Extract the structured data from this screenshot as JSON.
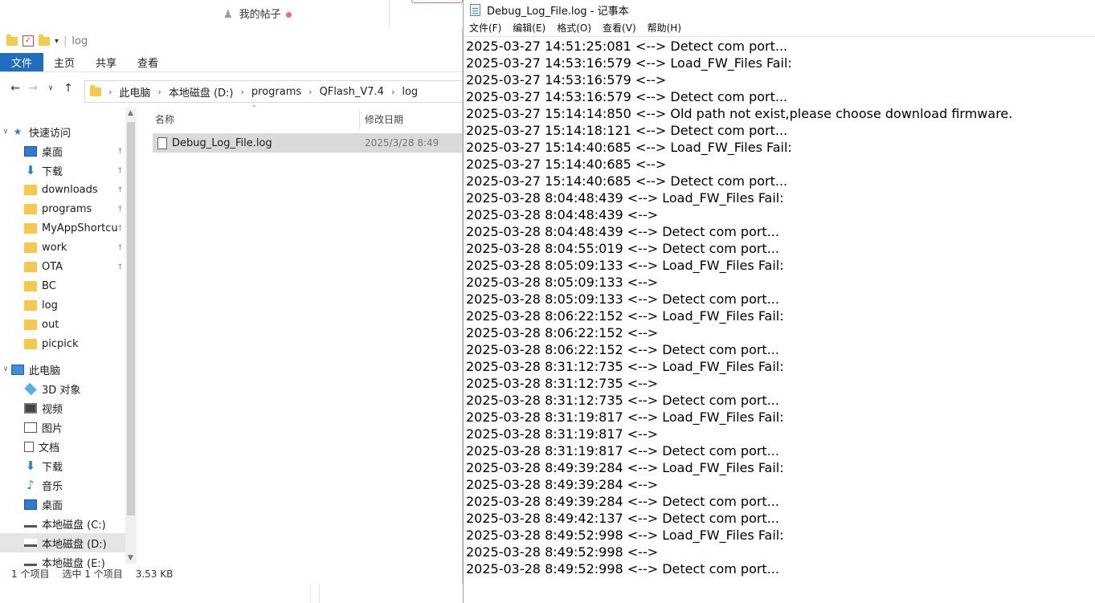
{
  "background": {
    "user_label": "我的帖子"
  },
  "explorer": {
    "title": "log",
    "ribbon_tabs": [
      "文件",
      "主页",
      "共享",
      "查看"
    ],
    "breadcrumb": [
      "此电脑",
      "本地磁盘 (D:)",
      "programs",
      "QFlash_V7.4",
      "log"
    ],
    "quick_access_label": "快速访问",
    "quick_access": [
      {
        "label": "桌面",
        "icon": "desktop-icon",
        "pinned": true
      },
      {
        "label": "下载",
        "icon": "download-icon",
        "pinned": true
      },
      {
        "label": "downloads",
        "icon": "folder-icon",
        "pinned": true
      },
      {
        "label": "programs",
        "icon": "folder-icon",
        "pinned": true
      },
      {
        "label": "MyAppShortcu",
        "icon": "folder-icon",
        "pinned": true
      },
      {
        "label": "work",
        "icon": "folder-icon",
        "pinned": true
      },
      {
        "label": "OTA",
        "icon": "folder-icon",
        "pinned": true
      },
      {
        "label": "BC",
        "icon": "folder-icon",
        "pinned": false
      },
      {
        "label": "log",
        "icon": "folder-icon",
        "pinned": false
      },
      {
        "label": "out",
        "icon": "folder-icon",
        "pinned": false
      },
      {
        "label": "picpick",
        "icon": "folder-icon",
        "pinned": false
      }
    ],
    "this_pc_label": "此电脑",
    "this_pc": [
      {
        "label": "3D 对象",
        "icon": "3d-objects-icon"
      },
      {
        "label": "视频",
        "icon": "video-icon"
      },
      {
        "label": "图片",
        "icon": "pictures-icon"
      },
      {
        "label": "文档",
        "icon": "documents-icon"
      },
      {
        "label": "下载",
        "icon": "download-icon"
      },
      {
        "label": "音乐",
        "icon": "music-icon"
      },
      {
        "label": "桌面",
        "icon": "desktop-icon"
      },
      {
        "label": "本地磁盘 (C:)",
        "icon": "drive-icon"
      },
      {
        "label": "本地磁盘 (D:)",
        "icon": "drive-icon",
        "selected": true
      },
      {
        "label": "本地磁盘 (E:)",
        "icon": "drive-icon"
      }
    ],
    "columns": {
      "name": "名称",
      "modified": "修改日期"
    },
    "files": [
      {
        "name": "Debug_Log_File.log",
        "modified": "2025/3/28 8:49"
      }
    ],
    "status": {
      "count": "1 个项目",
      "selected": "选中 1 个项目",
      "size": "3.53 KB"
    }
  },
  "notepad": {
    "title": "Debug_Log_File.log - 记事本",
    "menu": [
      "文件(F)",
      "编辑(E)",
      "格式(O)",
      "查看(V)",
      "帮助(H)"
    ],
    "lines": [
      "2025-03-27 14:51:25:081 <--> Detect com port...",
      "2025-03-27 14:53:16:579 <--> Load_FW_Files Fail:",
      "2025-03-27 14:53:16:579 <-->",
      "2025-03-27 14:53:16:579 <--> Detect com port...",
      "2025-03-27 15:14:14:850 <--> Old path not exist,please choose download firmware.",
      "2025-03-27 15:14:18:121 <--> Detect com port...",
      "2025-03-27 15:14:40:685 <--> Load_FW_Files Fail:",
      "2025-03-27 15:14:40:685 <-->",
      "2025-03-27 15:14:40:685 <--> Detect com port...",
      "2025-03-28 8:04:48:439 <--> Load_FW_Files Fail:",
      "2025-03-28 8:04:48:439 <-->",
      "2025-03-28 8:04:48:439 <--> Detect com port...",
      "2025-03-28 8:04:55:019 <--> Detect com port...",
      "2025-03-28 8:05:09:133 <--> Load_FW_Files Fail:",
      "2025-03-28 8:05:09:133 <-->",
      "2025-03-28 8:05:09:133 <--> Detect com port...",
      "2025-03-28 8:06:22:152 <--> Load_FW_Files Fail:",
      "2025-03-28 8:06:22:152 <-->",
      "2025-03-28 8:06:22:152 <--> Detect com port...",
      "2025-03-28 8:31:12:735 <--> Load_FW_Files Fail:",
      "2025-03-28 8:31:12:735 <-->",
      "2025-03-28 8:31:12:735 <--> Detect com port...",
      "2025-03-28 8:31:19:817 <--> Load_FW_Files Fail:",
      "2025-03-28 8:31:19:817 <-->",
      "2025-03-28 8:31:19:817 <--> Detect com port...",
      "2025-03-28 8:49:39:284 <--> Load_FW_Files Fail:",
      "2025-03-28 8:49:39:284 <-->",
      "2025-03-28 8:49:39:284 <--> Detect com port...",
      "2025-03-28 8:49:42:137 <--> Detect com port...",
      "2025-03-28 8:49:52:998 <--> Load_FW_Files Fail:",
      "2025-03-28 8:49:52:998 <-->",
      "2025-03-28 8:49:52:998 <--> Detect com port..."
    ]
  }
}
